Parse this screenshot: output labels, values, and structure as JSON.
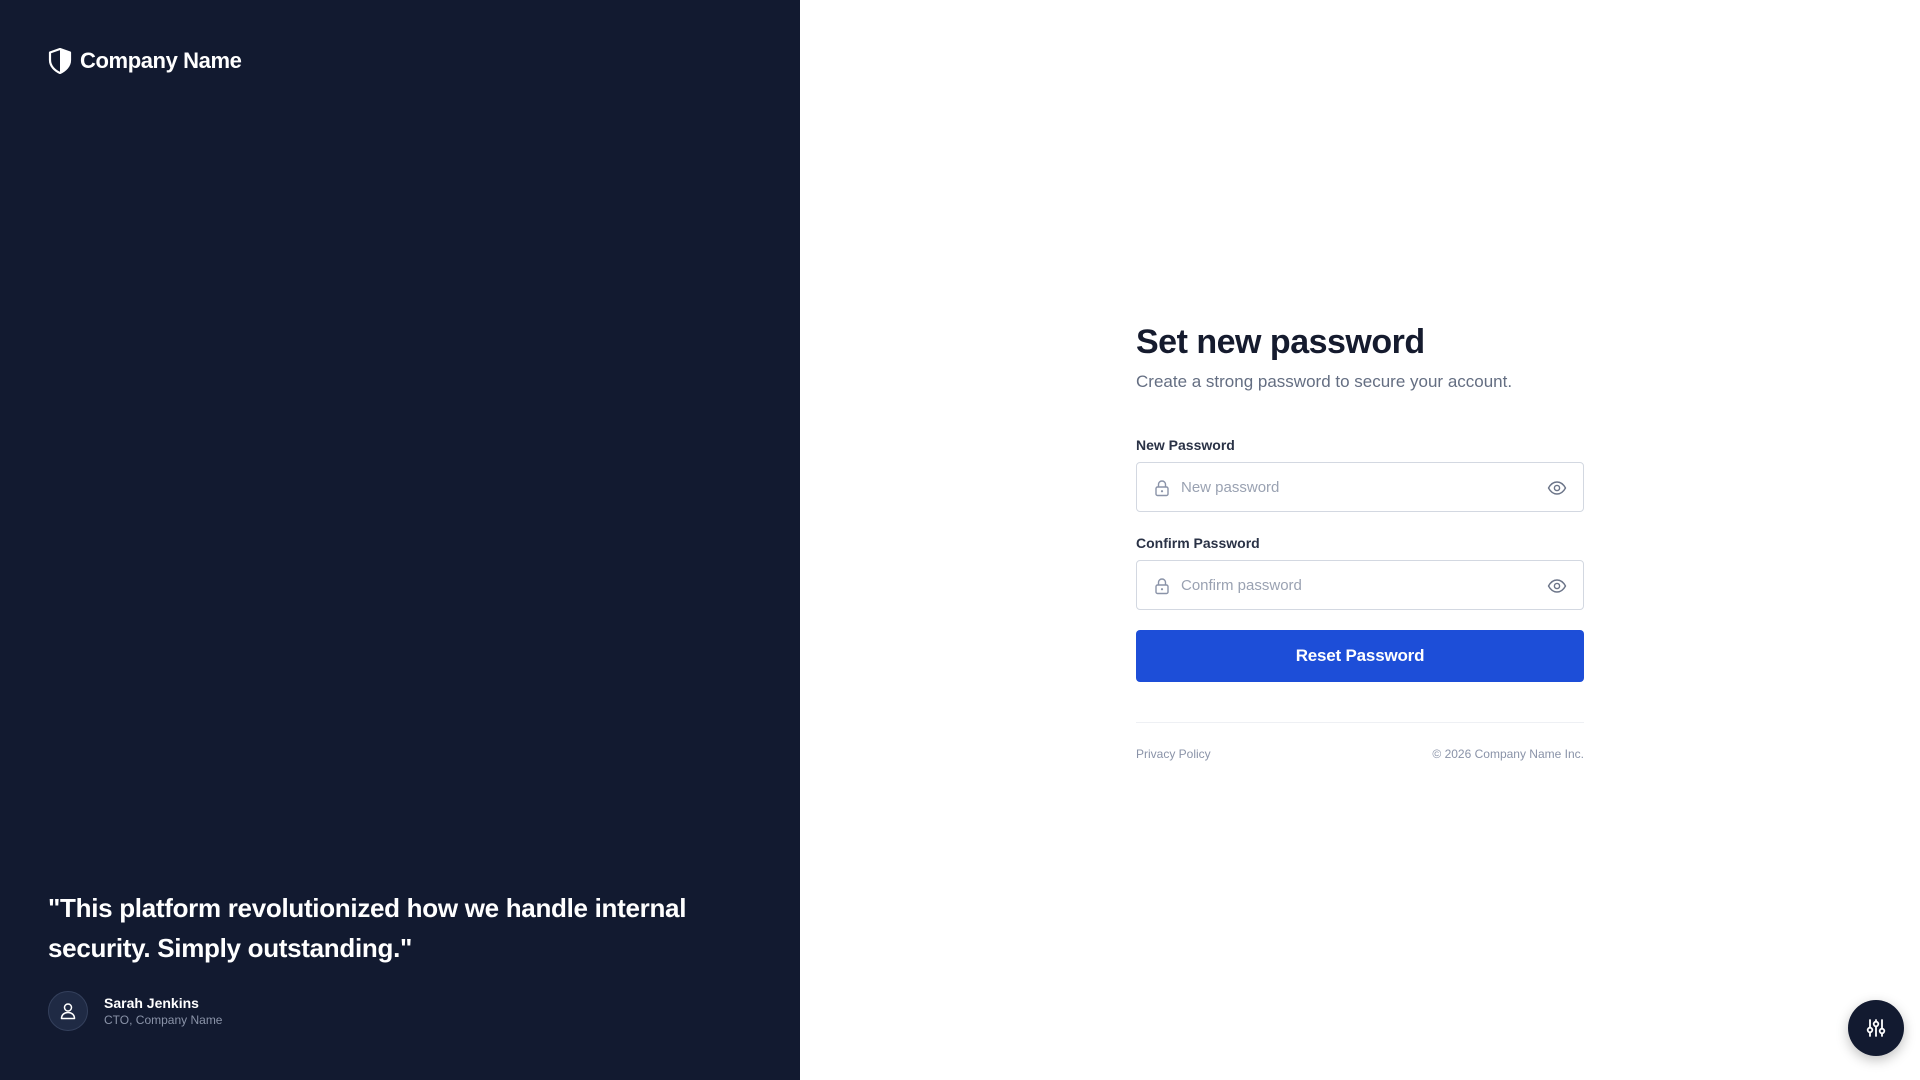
{
  "brand": {
    "name": "Company Name",
    "icon": "shield-icon"
  },
  "testimonial": {
    "quote": "\"This platform revolutionized how we handle internal security. Simply outstanding.\"",
    "author_name": "Sarah Jenkins",
    "author_role": "CTO, Company Name",
    "avatar_icon": "user-icon"
  },
  "form": {
    "title": "Set new password",
    "subtitle": "Create a strong password to secure your account.",
    "new_password": {
      "label": "New Password",
      "placeholder": "New password",
      "value": "",
      "left_icon": "lock-icon",
      "right_icon": "eye-icon"
    },
    "confirm_password": {
      "label": "Confirm Password",
      "placeholder": "Confirm password",
      "value": "",
      "left_icon": "lock-icon",
      "right_icon": "eye-icon"
    },
    "submit_label": "Reset Password"
  },
  "footer": {
    "privacy_link": "Privacy Policy",
    "copyright": "© 2026 Company Name Inc."
  },
  "fab": {
    "icon": "sliders-icon"
  },
  "colors": {
    "left_panel_bg": "#121a30",
    "primary_button": "#1d4ed8",
    "title_text": "#151b2e",
    "muted_text": "#646e82"
  }
}
